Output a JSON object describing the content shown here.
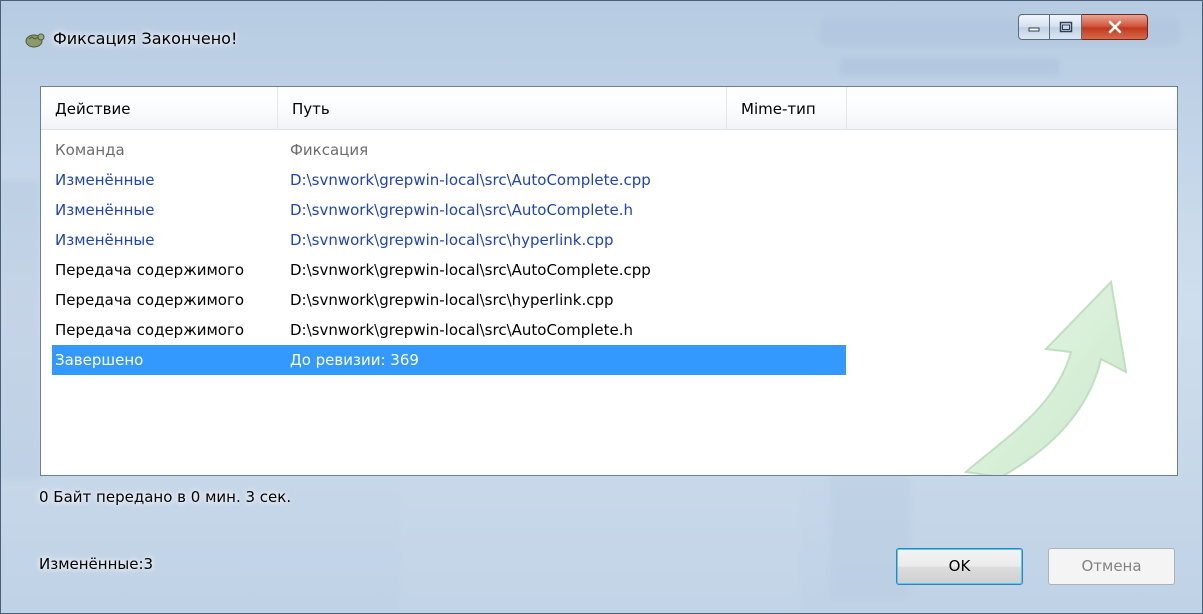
{
  "window": {
    "title": "Фиксация Закончено!",
    "accent": "#3399ff"
  },
  "list": {
    "columns": [
      "Действие",
      "Путь",
      "Mime-тип"
    ],
    "rows": [
      {
        "action": "Команда",
        "path": "Фиксация",
        "style": "gray"
      },
      {
        "action": "Изменённые",
        "path": "D:\\svnwork\\grepwin-local\\src\\AutoComplete.cpp",
        "style": "blue"
      },
      {
        "action": "Изменённые",
        "path": "D:\\svnwork\\grepwin-local\\src\\AutoComplete.h",
        "style": "blue"
      },
      {
        "action": "Изменённые",
        "path": "D:\\svnwork\\grepwin-local\\src\\hyperlink.cpp",
        "style": "blue"
      },
      {
        "action": "Передача содержимого",
        "path": "D:\\svnwork\\grepwin-local\\src\\AutoComplete.cpp",
        "style": "black"
      },
      {
        "action": "Передача содержимого",
        "path": "D:\\svnwork\\grepwin-local\\src\\hyperlink.cpp",
        "style": "black"
      },
      {
        "action": "Передача содержимого",
        "path": "D:\\svnwork\\grepwin-local\\src\\AutoComplete.h",
        "style": "black"
      },
      {
        "action": "Завершено",
        "path": "До ревизии: 369",
        "style": "sel"
      }
    ]
  },
  "status": {
    "transfer": "0 Байт передано в 0 мин. 3 сек.",
    "changed": "Изменённые:3"
  },
  "buttons": {
    "ok": "OK",
    "cancel": "Отмена"
  }
}
